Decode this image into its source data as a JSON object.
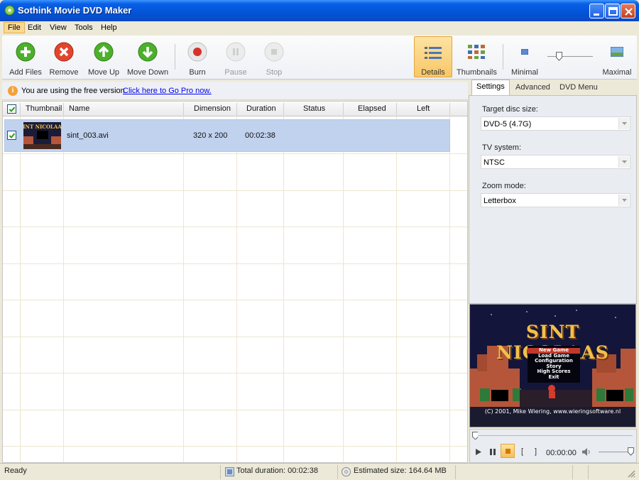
{
  "window": {
    "title": "Sothink Movie DVD Maker"
  },
  "menu": [
    "File",
    "Edit",
    "View",
    "Tools",
    "Help"
  ],
  "toolbar": {
    "add_files": "Add Files",
    "remove": "Remove",
    "move_up": "Move Up",
    "move_down": "Move Down",
    "burn": "Burn",
    "pause": "Pause",
    "stop": "Stop",
    "details": "Details",
    "thumbnails": "Thumbnails",
    "minimal": "Minimal",
    "maximal": "Maximal"
  },
  "notice": {
    "text": "You are using the free version.",
    "link": "Click here to Go Pro now."
  },
  "list": {
    "columns": [
      "Thumbnail",
      "Name",
      "Dimension",
      "Duration",
      "Status",
      "Elapsed",
      "Left"
    ],
    "rows": [
      {
        "name": "sint_003.avi",
        "dimension": "320 x 200",
        "duration": "00:02:38",
        "status": "",
        "elapsed": "",
        "left": ""
      }
    ]
  },
  "panel": {
    "tabs": [
      "Settings",
      "Advanced",
      "DVD Menu"
    ],
    "target_label": "Target disc size:",
    "target_value": "DVD-5 (4.7G)",
    "tv_label": "TV system:",
    "tv_value": "NTSC",
    "zoom_label": "Zoom mode:",
    "zoom_value": "Letterbox"
  },
  "preview": {
    "title": "SINT NICOLAAS",
    "menu": [
      "New Game",
      "Load Game",
      "Configuration",
      "Story",
      "High Scores",
      "Exit"
    ],
    "copyright": "(C) 2001, Mike Wiering, www.wieringsoftware.nl"
  },
  "player": {
    "time": "00:00:00",
    "open_bracket": "[",
    "close_bracket": "]"
  },
  "status": {
    "ready": "Ready",
    "total_duration": "Total duration: 00:02:38",
    "estimated_size": "Estimated size: 164.64 MB"
  }
}
